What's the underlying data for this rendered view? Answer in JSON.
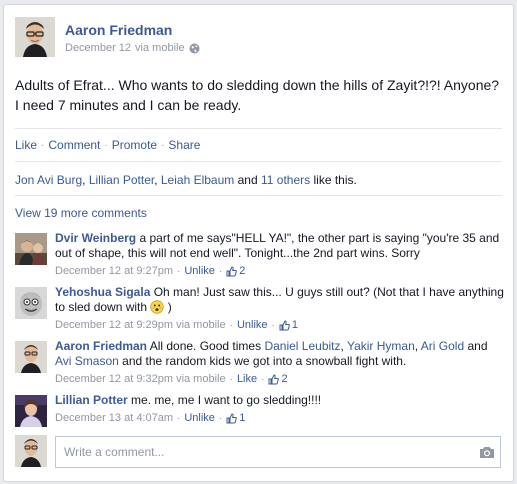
{
  "post": {
    "author": "Aaron Friedman",
    "date": "December 12",
    "via": "via mobile",
    "audience_icon": "globe-icon",
    "text": "Adults of Efrat... Who wants to do sledding down the hills of Zayit?!?! Anyone? I need 7 minutes and I can be ready."
  },
  "actions": {
    "like": "Like",
    "comment": "Comment",
    "promote": "Promote",
    "share": "Share"
  },
  "likes": {
    "names": [
      "Jon Avi Burg",
      "Lillian Potter",
      "Leiah Elbaum"
    ],
    "and_text": "and",
    "others": "11 others",
    "suffix": "like this."
  },
  "view_more": "View 19 more comments",
  "comments": [
    {
      "author": "Dvir Weinberg",
      "text": "a part of me says\"HELL YA!\", the other part is saying \"you're 35 and out of shape, this will not end well\". Tonight...the 2nd part wins. Sorry",
      "time": "December 12 at 9:27pm",
      "action": "Unlike",
      "likes": "2"
    },
    {
      "author": "Yehoshua Sigala",
      "text_before": "Oh man! Just saw this... U guys still out? (Not that I have anything to sled down with",
      "text_after": ")",
      "emoji_icon": "embarrassed-face-icon",
      "time": "December 12 at 9:29pm via mobile",
      "action": "Unlike",
      "likes": "1"
    },
    {
      "author": "Aaron Friedman",
      "text_1": "All done. Good times",
      "tag_1": "Daniel Leubitz",
      "tag_2": "Yakir Hyman",
      "tag_3": "Ari Gold",
      "tag_4": "Avi Smason",
      "text_and": "and",
      "text_2": "and the random kids we got into a snowball fight with.",
      "time": "December 12 at 9:32pm via mobile",
      "action": "Like",
      "likes": "2"
    },
    {
      "author": "Lillian Potter",
      "text": "me. me, me I want to go sledding!!!!",
      "time": "December 13 at 4:07am",
      "action": "Unlike",
      "likes": "1"
    }
  ],
  "compose": {
    "placeholder": "Write a comment...",
    "camera_icon": "camera-icon"
  },
  "colors": {
    "link": "#3b5998",
    "meta": "#9197a3",
    "text": "#141823",
    "border": "#d3d6db"
  }
}
